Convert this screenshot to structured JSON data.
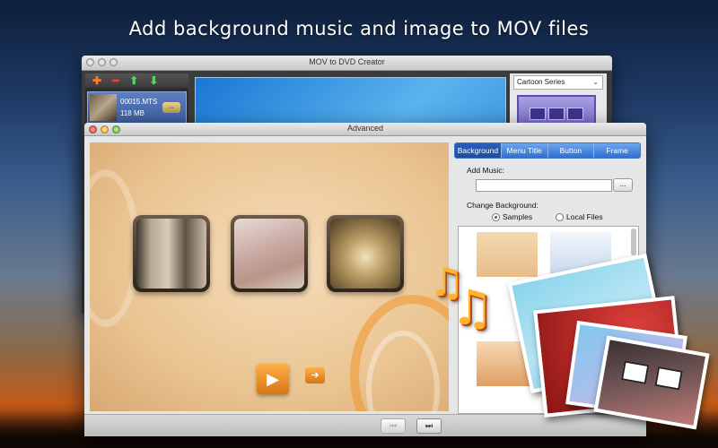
{
  "headline": "Add background music and image to MOV files",
  "back_window": {
    "title": "MOV to DVD Creator",
    "clip": {
      "name": "00015.MTS",
      "size": "118 MB"
    },
    "template_dropdown": "Cartoon Series"
  },
  "advanced_window": {
    "title": "Advanced",
    "tabs": [
      "Background",
      "Menu Title",
      "Button",
      "Frame"
    ],
    "active_tab": "Background",
    "add_music_label": "Add Music:",
    "add_music_value": "",
    "browse_label": "...",
    "change_background_label": "Change Background:",
    "background_source": {
      "options": [
        "Samples",
        "Local Files"
      ],
      "selected": "Samples"
    }
  },
  "colors": {
    "accent_orange": "#e08a1e",
    "tab_blue": "#2f6fd2",
    "back_preview_blue": "#1a77d4"
  },
  "icons": {
    "add": "plus-icon",
    "remove": "minus-icon",
    "move_up": "arrow-up-icon",
    "move_down": "arrow-down-icon",
    "play": "play-icon",
    "next": "arrow-right-icon",
    "prev_page": "skip-back-icon",
    "next_page": "skip-forward-icon",
    "music_notes": "music-notes-icon"
  }
}
